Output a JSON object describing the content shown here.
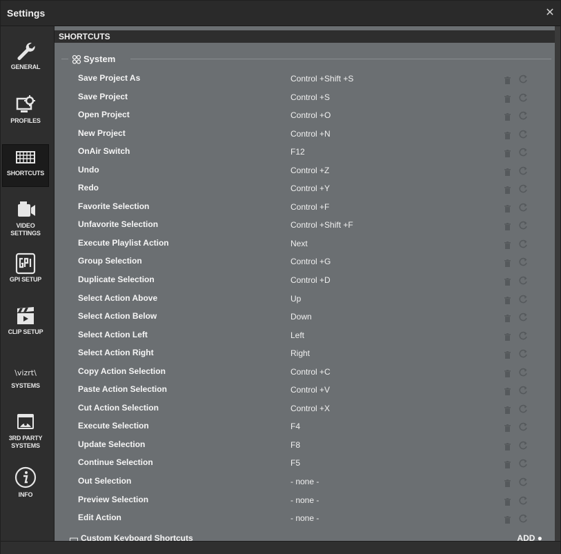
{
  "window": {
    "title": "Settings",
    "close_glyph": "✕"
  },
  "sidebar": {
    "items": [
      {
        "label": "GENERAL",
        "icon": "wrench-icon"
      },
      {
        "label": "PROFILES",
        "icon": "profile-monitor-gear-icon"
      },
      {
        "label": "SHORTCUTS",
        "icon": "keyboard-icon",
        "active": true
      },
      {
        "label": "VIDEO SETTINGS",
        "icon": "video-camera-icon"
      },
      {
        "label": "GPI SETUP",
        "icon": "gpi-icon"
      },
      {
        "label": "CLIP SETUP",
        "icon": "clapperboard-icon"
      },
      {
        "label": "SYSTEMS",
        "icon": "vizrt-logo-icon",
        "logo_text": "\\vizrt\\"
      },
      {
        "label": "3RD PARTY SYSTEMS",
        "icon": "third-party-window-icon"
      },
      {
        "label": "INFO",
        "icon": "info-icon"
      }
    ]
  },
  "main": {
    "section_title": "SHORTCUTS",
    "group_title": "System",
    "shortcuts": [
      {
        "name": "Save Project As",
        "key": "Control +Shift +S"
      },
      {
        "name": "Save Project",
        "key": "Control +S"
      },
      {
        "name": "Open Project",
        "key": "Control +O"
      },
      {
        "name": "New Project",
        "key": "Control +N"
      },
      {
        "name": "OnAir Switch",
        "key": "F12"
      },
      {
        "name": "Undo",
        "key": "Control +Z"
      },
      {
        "name": "Redo",
        "key": "Control +Y"
      },
      {
        "name": "Favorite Selection",
        "key": "Control +F"
      },
      {
        "name": "Unfavorite Selection",
        "key": "Control +Shift +F"
      },
      {
        "name": "Execute Playlist Action",
        "key": "Next"
      },
      {
        "name": "Group Selection",
        "key": "Control +G"
      },
      {
        "name": "Duplicate Selection",
        "key": "Control +D"
      },
      {
        "name": "Select Action Above",
        "key": "Up"
      },
      {
        "name": "Select Action Below",
        "key": "Down"
      },
      {
        "name": "Select Action Left",
        "key": "Left"
      },
      {
        "name": "Select Action Right",
        "key": "Right"
      },
      {
        "name": "Copy Action Selection",
        "key": "Control +C"
      },
      {
        "name": "Paste Action Selection",
        "key": "Control +V"
      },
      {
        "name": "Cut Action Selection",
        "key": "Control +X"
      },
      {
        "name": "Execute Selection",
        "key": "F4"
      },
      {
        "name": "Update Selection",
        "key": "F8"
      },
      {
        "name": "Continue Selection",
        "key": "F5"
      },
      {
        "name": "Out Selection",
        "key": "- none -"
      },
      {
        "name": "Preview Selection",
        "key": "- none -"
      },
      {
        "name": "Edit Action",
        "key": "- none -"
      }
    ],
    "custom_section_title": "Custom Keyboard Shortcuts",
    "add_label": "ADD"
  }
}
